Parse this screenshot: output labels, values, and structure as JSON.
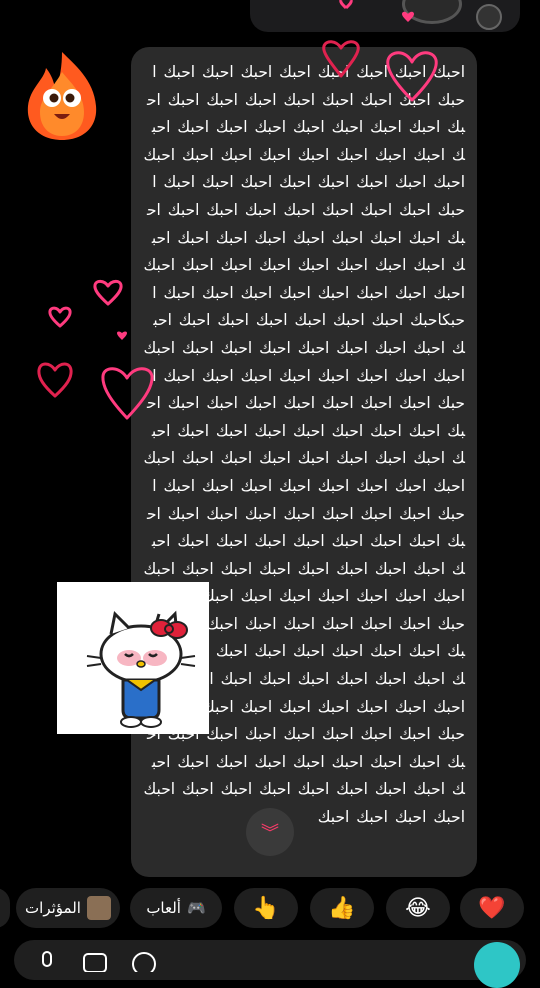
{
  "message": {
    "text": "احبك احبك احبك احبك احبك احبك احبك احبك احبك احبك احبك احبك احبك احبك احبك احبك احبك احبك احبك احبك احبك احبك احبك احبك احبك احبك احبك احبك احبك احبك احبك احبك احبك احبك احبك احبك احبك احبك احبك احبك احبك احبك احبك احبك احبك احبك احبك احبك احبك احبك احبك احبك احبك احبك احبك احبك احبك احبك احبك احبك احبك احبك احبك احبك احبك احبك احبك احبك احبك احبك احبك احبك احبك احبك احبكاحبك احبك احبك احبك احبك احبك احبك احبك احبك احبك احبك احبك احبك احبك احبك احبك احبك احبك احبك احبك احبك احبك احبك احبك احبك احبك احبك احبك احبك احبك احبك احبك احبك احبك احبك احبك احبك احبك احبك احبك احبك احبك احبك احبك احبك احبك احبك احبك احبك احبك احبك احبك احبك احبك احبك احبك احبك احبك احبك احبك احبك احبك احبك احبك احبك احبك احبك احبك احبك احبك احبك احبك احبك احبك احبك احبك احبك احبك احبك احبك احبك احبك احبك احبك احبك احبك احبك احبك احبك احبك احبك احبك احبك احبك احبك احبك احبك احبك احبك احبك احبك احبك احبك احبك احبك احبك احبك احبك احبك احبك احبك احبك احبك احبك احبك احبك احبك احبك احبك احبك احبك احبك احبك احبك احبك احبك احبك احبك احبك احبك احبك احبك احبك احبك احبك احبك احبك احبك احبك احبك احبك احبك احبك احبك احبك احبك احبك احبك احبك احبك احبك احبك"
  },
  "reactions": {
    "heart": "❤️",
    "laugh": "😂",
    "thumbs_up": "👍",
    "point": "👆",
    "games_label": "ألعاب",
    "games_icon": "🎮",
    "effects_label": "المؤثرات"
  },
  "colors": {
    "bubble": "#2b2b2b",
    "heart_pink": "#ff3b7f",
    "heart_red": "#e0224f",
    "send_button": "#2ec6c6"
  }
}
